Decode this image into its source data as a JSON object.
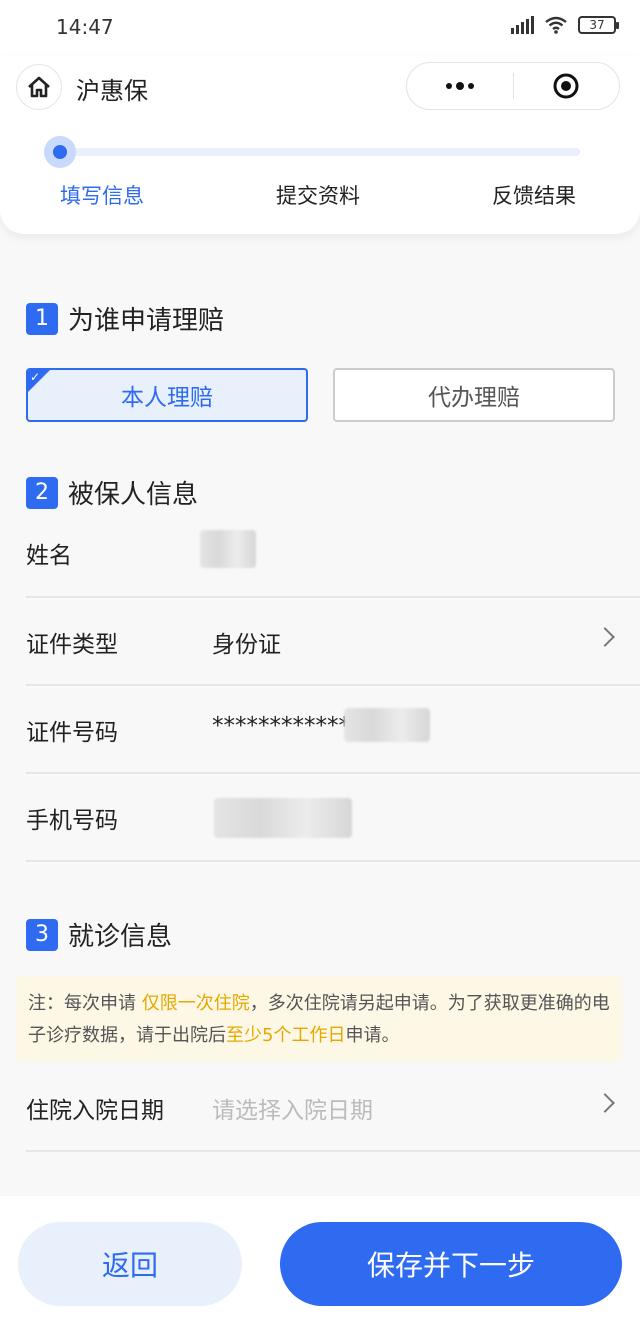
{
  "status": {
    "time": "14:47",
    "battery": "37"
  },
  "header": {
    "title": "沪惠保"
  },
  "steps": [
    "填写信息",
    "提交资料",
    "反馈结果"
  ],
  "section1": {
    "num": "1",
    "title": "为谁申请理赔",
    "options": [
      "本人理赔",
      "代办理赔"
    ]
  },
  "section2": {
    "num": "2",
    "title": "被保人信息",
    "name_label": "姓名",
    "id_type_label": "证件类型",
    "id_type_value": "身份证",
    "id_number_label": "证件号码",
    "id_number_value": "************",
    "phone_label": "手机号码"
  },
  "section3": {
    "num": "3",
    "title": "就诊信息",
    "note_prefix": "注：每次申请 ",
    "note_hl1": "仅限一次住院",
    "note_mid": "，多次住院请另起申请。为了获取更准确的电子诊疗数据，请于出院后",
    "note_hl2": "至少5个工作日",
    "note_suffix": "申请。",
    "admission_label": "住院入院日期",
    "admission_placeholder": "请选择入院日期"
  },
  "buttons": {
    "back": "返回",
    "next": "保存并下一步"
  },
  "colors": {
    "accent": "#2f6bf0",
    "highlight": "#e6a800"
  }
}
